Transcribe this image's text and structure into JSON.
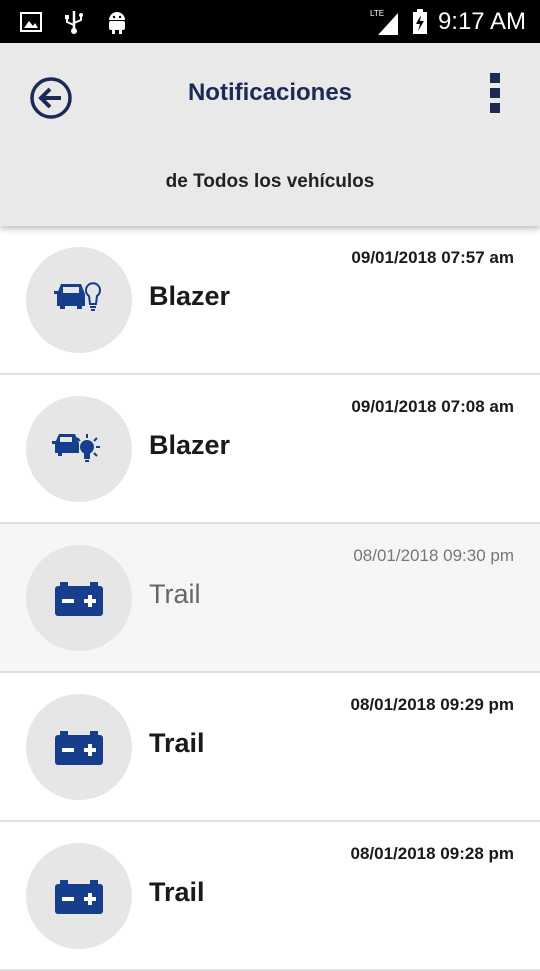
{
  "status_bar": {
    "time": "9:17 AM",
    "network": "LTE",
    "icons": [
      "image-icon",
      "usb-icon",
      "android-icon",
      "signal-icon",
      "battery-charging-icon"
    ]
  },
  "header": {
    "title": "Notificaciones",
    "subtitle": "de Todos los vehículos",
    "back_icon": "back-arrow-icon",
    "menu_icon": "more-vertical-icon"
  },
  "notifications": [
    {
      "vehicle": "Blazer",
      "datetime": "09/01/2018 07:57 am",
      "icon": "car-light-icon",
      "read": false
    },
    {
      "vehicle": "Blazer",
      "datetime": "09/01/2018 07:08 am",
      "icon": "car-bulb-alert-icon",
      "read": false
    },
    {
      "vehicle": "Trail",
      "datetime": "08/01/2018 09:30 pm",
      "icon": "battery-icon",
      "read": true
    },
    {
      "vehicle": "Trail",
      "datetime": "08/01/2018 09:29 pm",
      "icon": "battery-icon",
      "read": false
    },
    {
      "vehicle": "Trail",
      "datetime": "08/01/2018 09:28 pm",
      "icon": "battery-icon",
      "read": false
    }
  ],
  "colors": {
    "brand_navy": "#1b2a57",
    "icon_blue": "#173e8c",
    "header_bg": "#e9e9e9",
    "circle_bg": "#e6e6e6"
  }
}
